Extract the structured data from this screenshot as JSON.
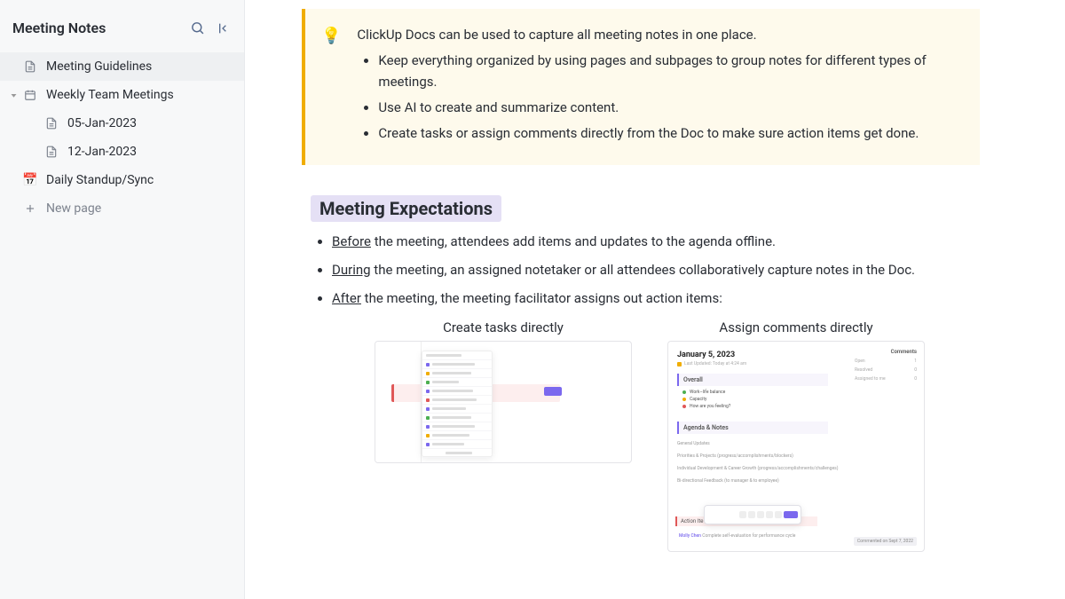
{
  "sidebar": {
    "title": "Meeting Notes",
    "items": [
      {
        "label": "Meeting Guidelines",
        "icon": "doc"
      },
      {
        "label": "Weekly Team Meetings",
        "icon": "cal-grid",
        "expanded": true
      },
      {
        "label": "05-Jan-2023",
        "icon": "doc",
        "child": true
      },
      {
        "label": "12-Jan-2023",
        "icon": "doc",
        "child": true
      },
      {
        "label": "Daily Standup/Sync",
        "icon": "cal-emoji"
      }
    ],
    "new_page": "New page"
  },
  "callout": {
    "icon": "💡",
    "lead": "ClickUp Docs can be used to capture all meeting notes in one place.",
    "bullets": [
      "Keep everything organized by using pages and subpages to group notes for different types of meetings.",
      "Use AI to create and summarize content.",
      "Create tasks or assign comments directly from the Doc to make sure action items get done."
    ]
  },
  "section": {
    "heading": "Meeting Expectations",
    "items": [
      {
        "u": "Before",
        "rest": " the meeting, attendees add items and updates to the agenda offline."
      },
      {
        "u": "During",
        "rest": " the meeting, an assigned notetaker or all attendees collaboratively capture notes in the Doc."
      },
      {
        "u": "After",
        "rest": " the meeting, the meeting facilitator assigns out action items:"
      }
    ]
  },
  "images": {
    "caption1": "Create tasks directly",
    "caption2": "Assign comments directly"
  },
  "mock2": {
    "date": "January 5, 2023",
    "priv": "Last Updated: Today at 4:24 am",
    "overall": "Overall",
    "dot1": "Work–life balance",
    "dot2": "Capacity",
    "dot3": "How are you feeling?",
    "agenda": "Agenda & Notes",
    "general": "General Updates",
    "prio": "Priorities & Projects",
    "prio_sub": "(progress/accomplishments/blockers)",
    "dev": "Individual Development & Career Growth",
    "dev_sub": "(progress/accomplishments/challenges)",
    "feedback": "Bi-directional Feedback",
    "feedback_sub": "(to manager & to employee)",
    "action": "Action Ite",
    "assign": "Complete self-evaluation for performance cycle",
    "assign_who": "Molly Chen",
    "comments": "Comments",
    "c_open": "Open",
    "c_res": "Resolved",
    "c_assign": "Assigned to me",
    "time": "Commented on Sept 7, 2022"
  }
}
